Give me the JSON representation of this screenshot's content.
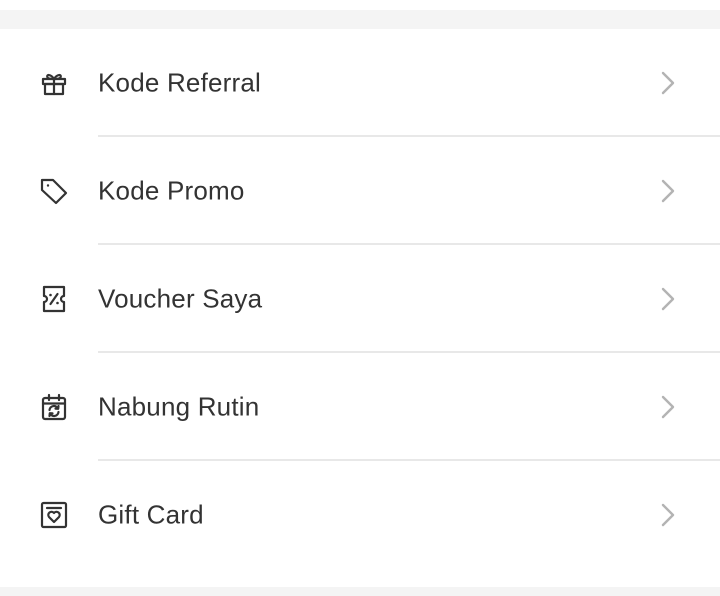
{
  "menu": {
    "items": [
      {
        "id": "referral",
        "label": "Kode Referral",
        "icon": "gift-icon"
      },
      {
        "id": "promo",
        "label": "Kode Promo",
        "icon": "tag-icon"
      },
      {
        "id": "voucher",
        "label": "Voucher Saya",
        "icon": "voucher-icon"
      },
      {
        "id": "nabung",
        "label": "Nabung Rutin",
        "icon": "calendar-repeat-icon"
      },
      {
        "id": "giftcard",
        "label": "Gift Card",
        "icon": "gift-card-icon"
      }
    ]
  },
  "colors": {
    "background": "#f4f4f4",
    "card": "#ffffff",
    "text": "#333333",
    "icon": "#333333",
    "chevron": "#b3b3b3",
    "divider": "#e8e8e8"
  }
}
